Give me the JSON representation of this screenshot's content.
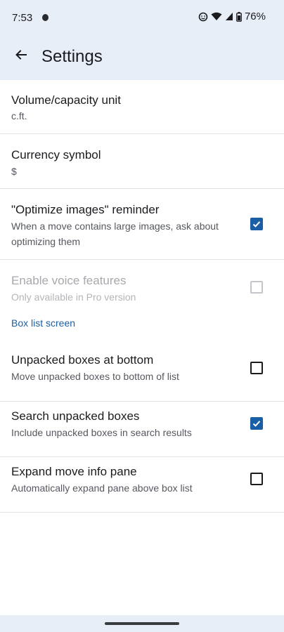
{
  "status": {
    "time": "7:53",
    "battery": "76%"
  },
  "appbar": {
    "title": "Settings"
  },
  "settings": [
    {
      "title": "Volume/capacity unit",
      "summary": "c.ft."
    },
    {
      "title": "Currency symbol",
      "summary": "$"
    },
    {
      "title": "\"Optimize images\" reminder",
      "summary": "When a move contains large images, ask about optimizing them",
      "checked": true
    },
    {
      "title": "Enable voice features",
      "summary": "Only available in Pro version",
      "checked": false,
      "enabled": false
    }
  ],
  "box_list": {
    "header": "Box list screen",
    "items": [
      {
        "title": "Unpacked boxes at bottom",
        "summary": "Move unpacked boxes to bottom of list",
        "checked": false
      },
      {
        "title": "Search unpacked boxes",
        "summary": "Include unpacked boxes in search results",
        "checked": true
      },
      {
        "title": "Expand move info pane",
        "summary": "Automatically expand pane above box list",
        "checked": false
      }
    ]
  },
  "colors": {
    "accent": "#1a5fa6",
    "bar_background": "#e7eef7"
  }
}
